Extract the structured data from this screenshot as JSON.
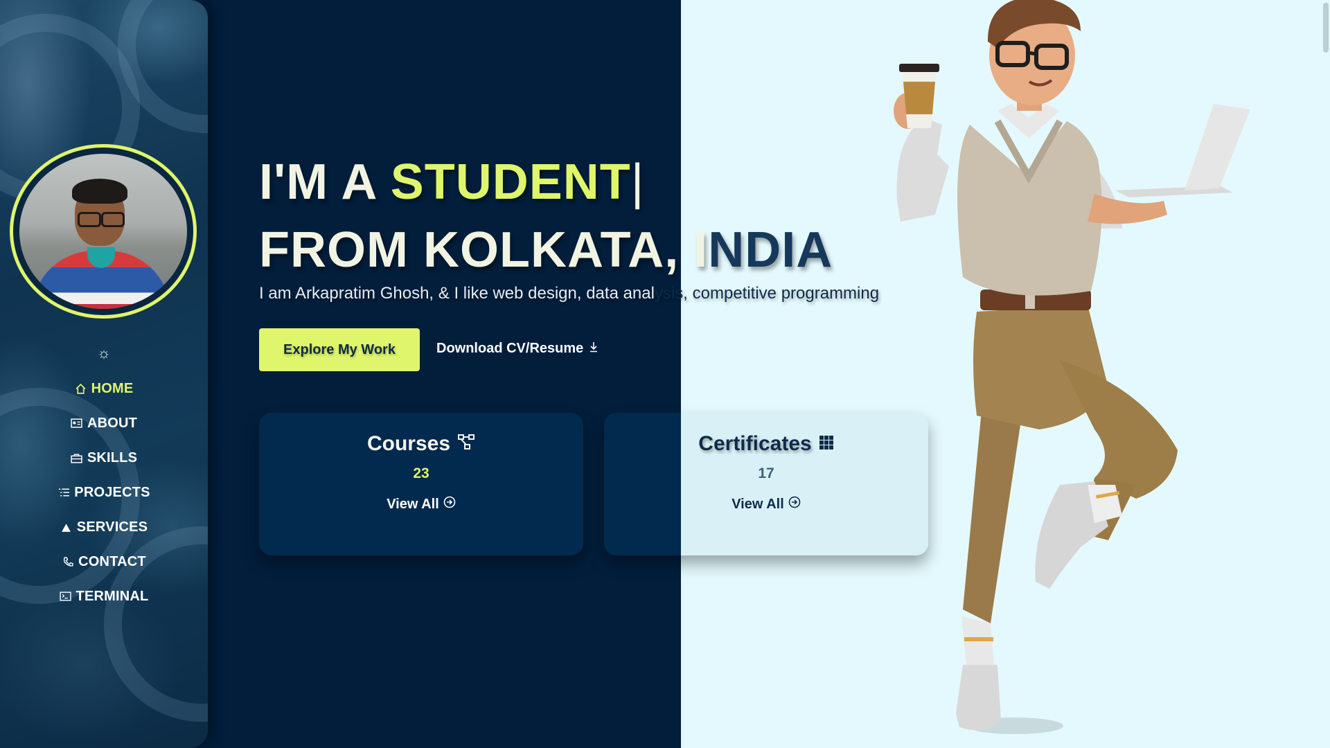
{
  "sidebar": {
    "nav": [
      {
        "label": "HOME",
        "icon": "home-icon",
        "active": true
      },
      {
        "label": "ABOUT",
        "icon": "id-card-icon"
      },
      {
        "label": "SKILLS",
        "icon": "briefcase-icon"
      },
      {
        "label": "PROJECTS",
        "icon": "list-icon"
      },
      {
        "label": "SERVICES",
        "icon": "ship-icon"
      },
      {
        "label": "CONTACT",
        "icon": "phone-icon"
      },
      {
        "label": "TERMINAL",
        "icon": "terminal-icon"
      }
    ],
    "theme_icon": "☼"
  },
  "hero": {
    "line1_prefix": "I'M A ",
    "line1_highlight": "STUDENT",
    "cursor": "|",
    "line2_dark_part": "FROM KOLKATA, I",
    "line2_light_part": "NDIA",
    "subtitle_dark_part": "I am Arkapratim Ghosh, & I like web design, data anal",
    "subtitle_light_part": "ysis, competitive programming",
    "explore_label": "Explore My Work",
    "download_label": "Download CV/Resume"
  },
  "cards": {
    "courses": {
      "title": "Courses",
      "count": "23",
      "link": "View All"
    },
    "certificates": {
      "title": "Certificates",
      "count": "17",
      "link": "View All"
    }
  },
  "colors": {
    "accent": "#dff56b",
    "dark_bg": "#021e3b",
    "light_bg": "#e4f9fd"
  }
}
